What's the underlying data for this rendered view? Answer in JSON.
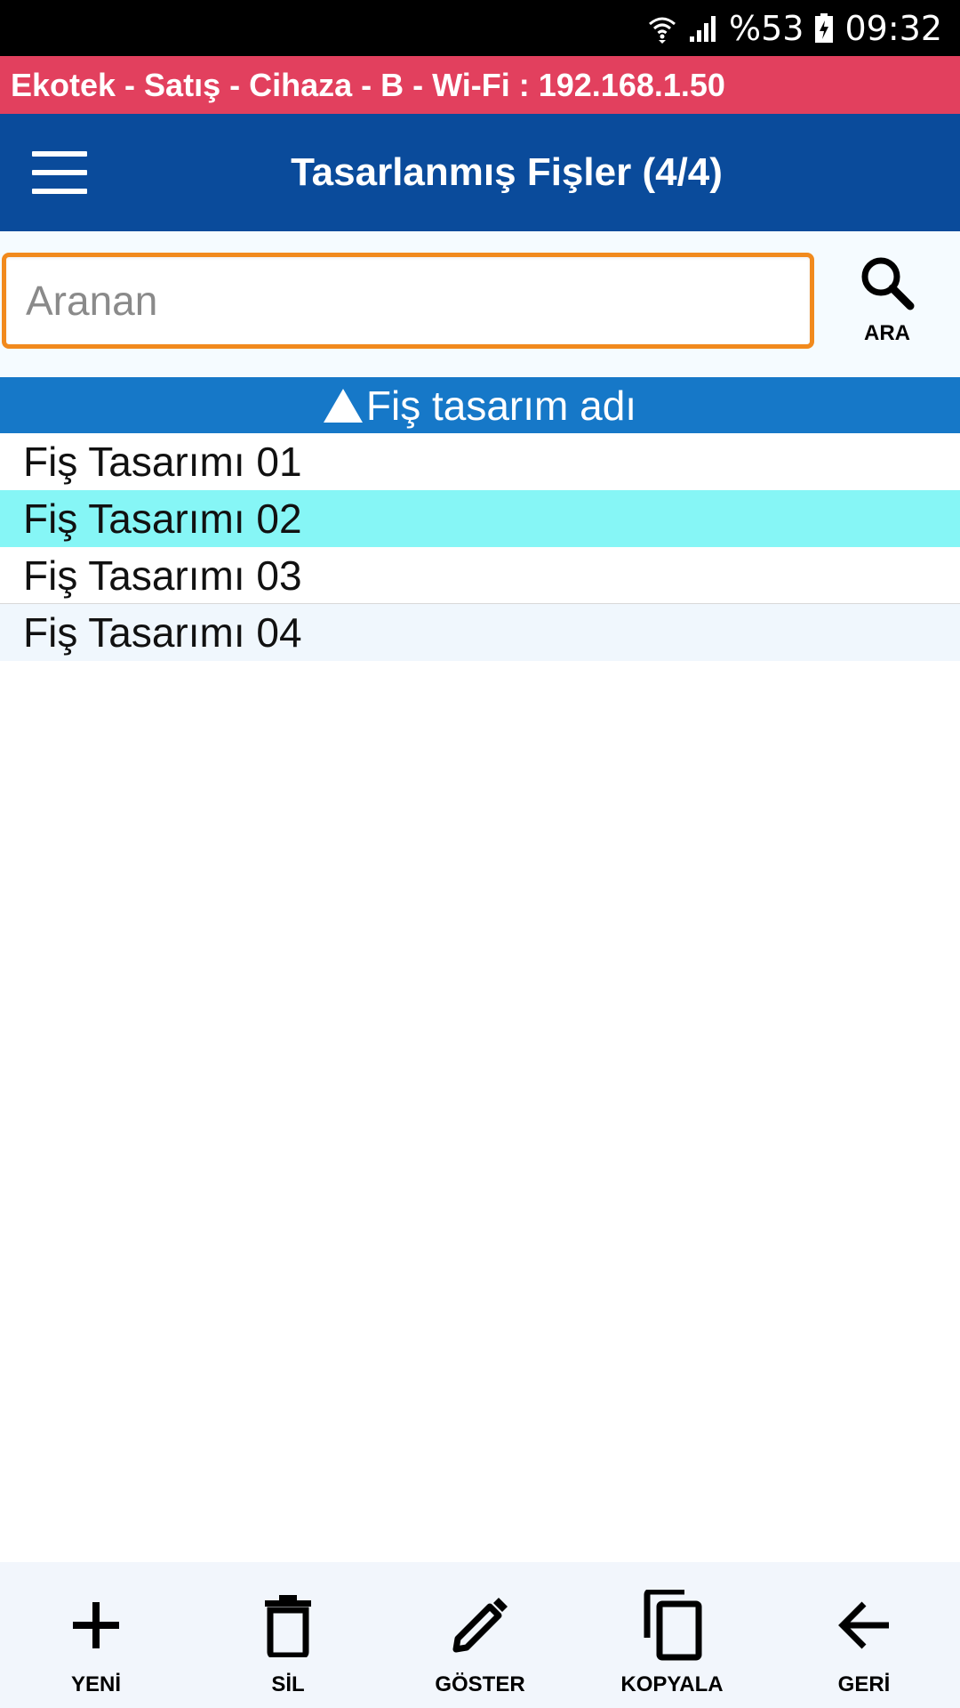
{
  "status_bar": {
    "battery": "%53",
    "time": "09:32",
    "icons": [
      "wifi-icon",
      "signal-icon",
      "battery-icon"
    ]
  },
  "info_bar": {
    "text": "Ekotek - Satış - Cihaza - B - Wi-Fi : 192.168.1.50"
  },
  "app_bar": {
    "title": "Tasarlanmış Fişler (4/4)",
    "menu_icon": "hamburger-menu-icon"
  },
  "search": {
    "placeholder": "Aranan",
    "value": "",
    "button_label": "ARA",
    "button_icon": "search-icon"
  },
  "list": {
    "column_header": "Fiş tasarım adı",
    "sort": "ascending",
    "items": [
      {
        "label": "Fiş Tasarımı 01",
        "selected": false
      },
      {
        "label": "Fiş Tasarımı 02",
        "selected": true
      },
      {
        "label": "Fiş Tasarımı 03",
        "selected": false
      },
      {
        "label": "Fiş Tasarımı 04",
        "selected": false
      }
    ]
  },
  "bottom_bar": {
    "buttons": [
      {
        "label": "YENİ",
        "icon": "plus-icon"
      },
      {
        "label": "SİL",
        "icon": "trash-icon"
      },
      {
        "label": "GÖSTER",
        "icon": "pencil-icon"
      },
      {
        "label": "KOPYALA",
        "icon": "copy-icon"
      },
      {
        "label": "GERİ",
        "icon": "arrow-left-icon"
      }
    ]
  },
  "colors": {
    "status_bar": "#000000",
    "info_bar": "#e2405e",
    "app_bar": "#0a4b9b",
    "column_header": "#1678c8",
    "selected_row": "#86f6f6",
    "search_border": "#f18a1d",
    "bottom_bar": "#f2f6fc"
  }
}
